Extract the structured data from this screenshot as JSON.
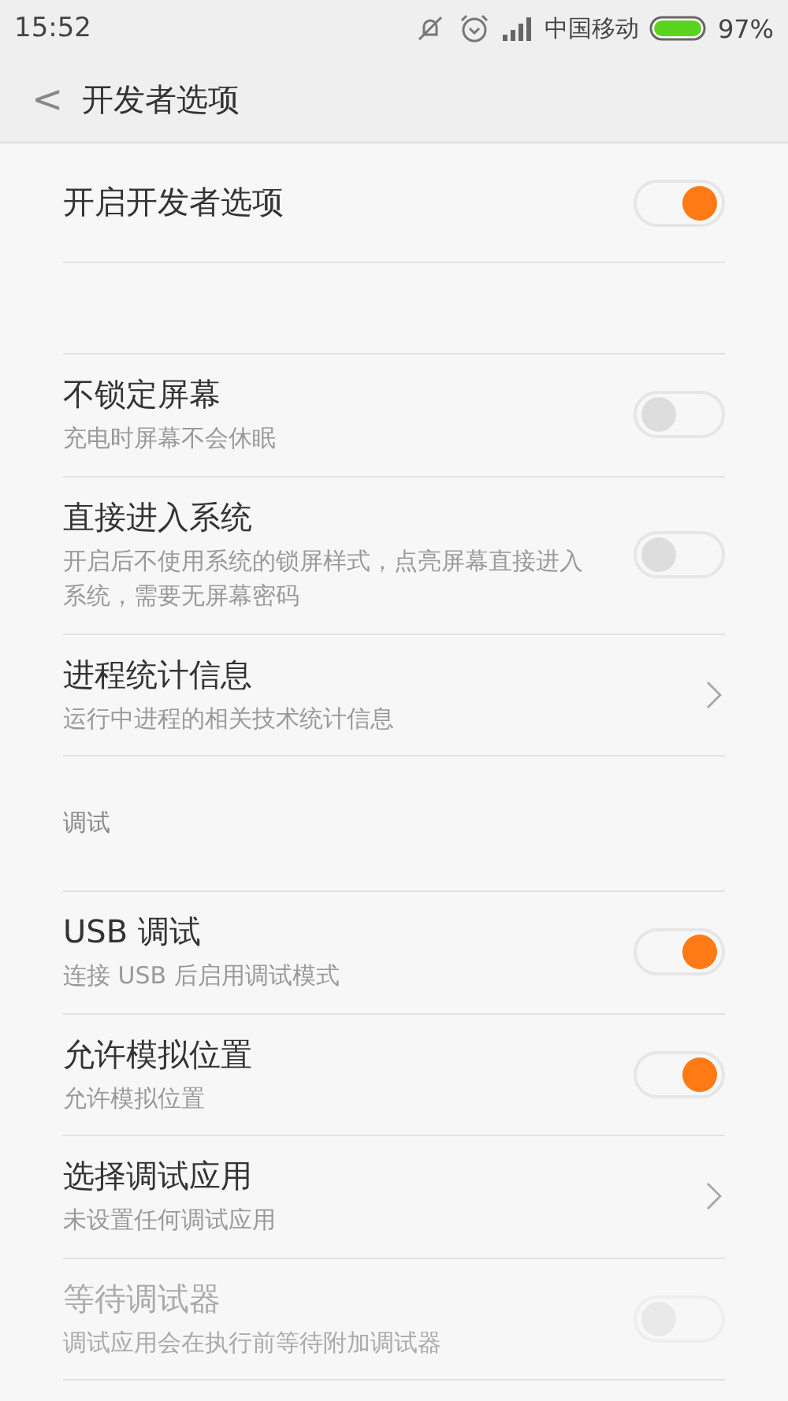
{
  "status_bar": {
    "time": "15:52",
    "carrier": "中国移动",
    "battery": "97%"
  },
  "header": {
    "back": "<",
    "title": "开发者选项"
  },
  "sections": [
    {
      "items": [
        {
          "kind": "toggle",
          "title": "开启开发者选项",
          "on": true,
          "disabled": false
        }
      ]
    },
    {
      "items": [
        {
          "kind": "toggle",
          "title": "不锁定屏幕",
          "subtitle": "充电时屏幕不会休眠",
          "on": false,
          "disabled": false
        },
        {
          "kind": "toggle",
          "title": "直接进入系统",
          "subtitle": "开启后不使用系统的锁屏样式，点亮屏幕直接进入系统，需要无屏幕密码",
          "on": false,
          "disabled": false
        },
        {
          "kind": "link",
          "title": "进程统计信息",
          "subtitle": "运行中进程的相关技术统计信息",
          "disabled": false
        }
      ]
    },
    {
      "heading": "调试",
      "items": [
        {
          "kind": "toggle",
          "title": "USB 调试",
          "subtitle": "连接 USB 后启用调试模式",
          "on": true,
          "disabled": false
        },
        {
          "kind": "toggle",
          "title": "允许模拟位置",
          "subtitle": "允许模拟位置",
          "on": true,
          "disabled": false
        },
        {
          "kind": "link",
          "title": "选择调试应用",
          "subtitle": "未设置任何调试应用",
          "disabled": false
        },
        {
          "kind": "toggle",
          "title": "等待调试器",
          "subtitle": "调试应用会在执行前等待附加调试器",
          "on": false,
          "disabled": true
        }
      ]
    }
  ]
}
